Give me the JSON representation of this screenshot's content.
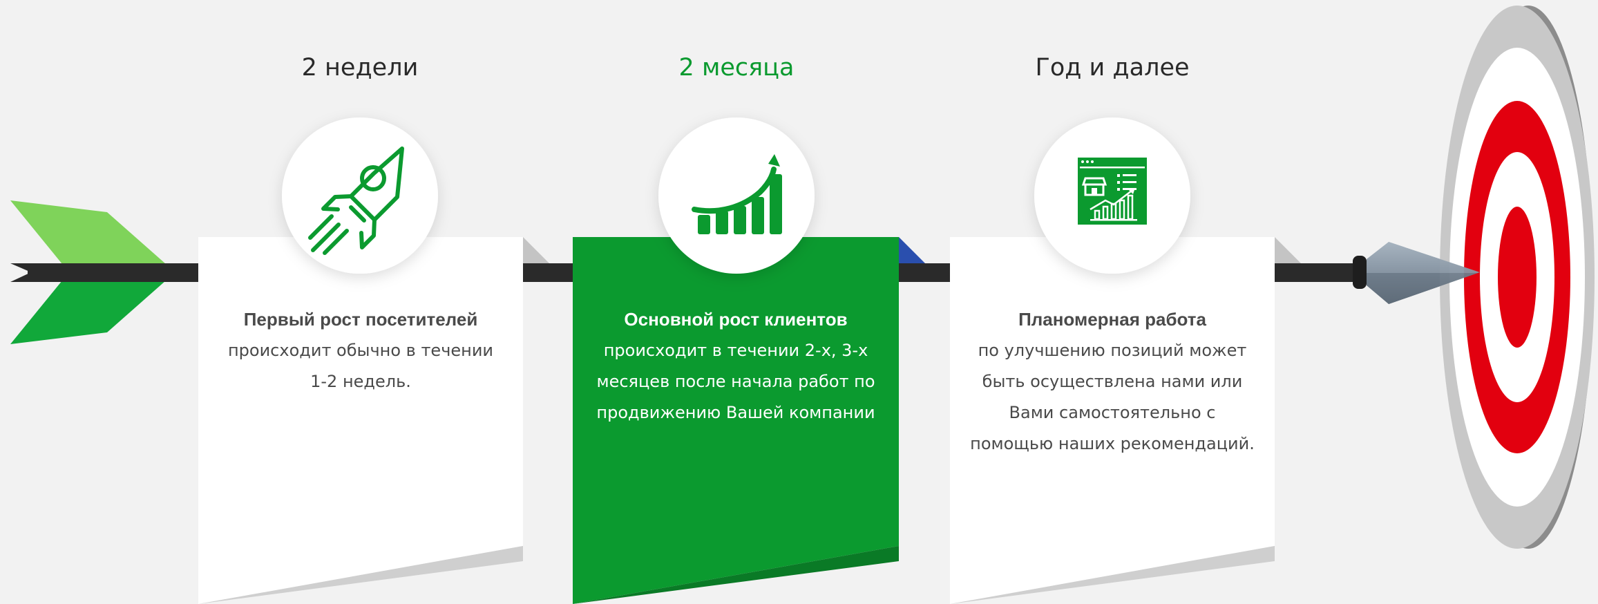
{
  "stages": [
    {
      "title": "2 недели",
      "icon": "rocket-icon",
      "heading": "Первый рост посетителей",
      "lines": [
        "происходит обычно в течении",
        "1-2 недель."
      ],
      "active": false
    },
    {
      "title": "2 месяца",
      "icon": "growth-chart-icon",
      "heading": "Основной рост клиентов",
      "lines": [
        "происходит  в течении 2-х, 3-х",
        "месяцев после начала работ по",
        "продвижению Вашей компании"
      ],
      "active": true
    },
    {
      "title": "Год и далее",
      "icon": "web-store-analytics-icon",
      "heading": "Планомерная работа",
      "lines": [
        "по улучшению позиций может",
        "быть осуществлена нами или",
        "Вами самостоятельно с",
        "помощью наших рекомендаций."
      ],
      "active": false
    }
  ],
  "colors": {
    "background": "#f2f2f2",
    "accent_green": "#0b9a2f",
    "fletching_light": "#7fd35a",
    "fletching_dark": "#11a83a",
    "shaft": "#2a2a2a",
    "target_red": "#e2000f",
    "target_white": "#ffffff",
    "target_grey": "#c8c8c8"
  },
  "decor": {
    "arrow": "arrow-icon",
    "target": "target-icon"
  }
}
